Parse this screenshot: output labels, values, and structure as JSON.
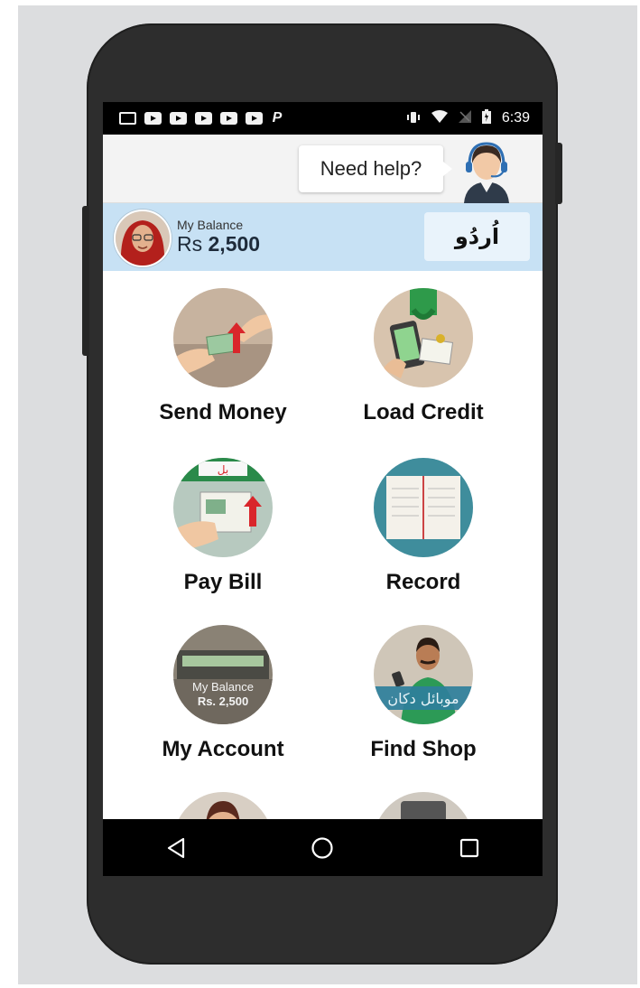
{
  "status_bar": {
    "left_icons": [
      "screen-cast-icon",
      "youtube-icon",
      "youtube-icon",
      "youtube-icon",
      "youtube-icon",
      "youtube-icon",
      "paypal-icon"
    ],
    "right_icons": [
      "vibrate-icon",
      "wifi-icon",
      "no-signal-icon",
      "battery-icon"
    ],
    "time": "6:39"
  },
  "header": {
    "help_label": "Need help?",
    "agent_icon": "support-agent-icon"
  },
  "balance": {
    "label": "My Balance",
    "currency": "Rs",
    "amount": "2,500",
    "language_button": "اُردُو"
  },
  "tiles": [
    {
      "label": "Send Money",
      "icon": "send-money-icon"
    },
    {
      "label": "Load Credit",
      "icon": "load-credit-icon"
    },
    {
      "label": "Pay Bill",
      "icon": "pay-bill-icon",
      "badge_text": "بل"
    },
    {
      "label": "Record",
      "icon": "record-book-icon"
    },
    {
      "label": "My Account",
      "icon": "wallet-icon",
      "image_text_1": "My Balance",
      "image_text_2": "Rs. 2,500"
    },
    {
      "label": "Find Shop",
      "icon": "shopkeeper-icon",
      "image_text": "موبائل دکان"
    }
  ],
  "nav": {
    "back_icon": "back-triangle-icon",
    "home_icon": "home-circle-icon",
    "recents_icon": "recents-square-icon"
  },
  "colors": {
    "balance_bar": "#c7e1f4",
    "phone_body": "#2d2d2d",
    "backdrop": "#dcdddf"
  }
}
